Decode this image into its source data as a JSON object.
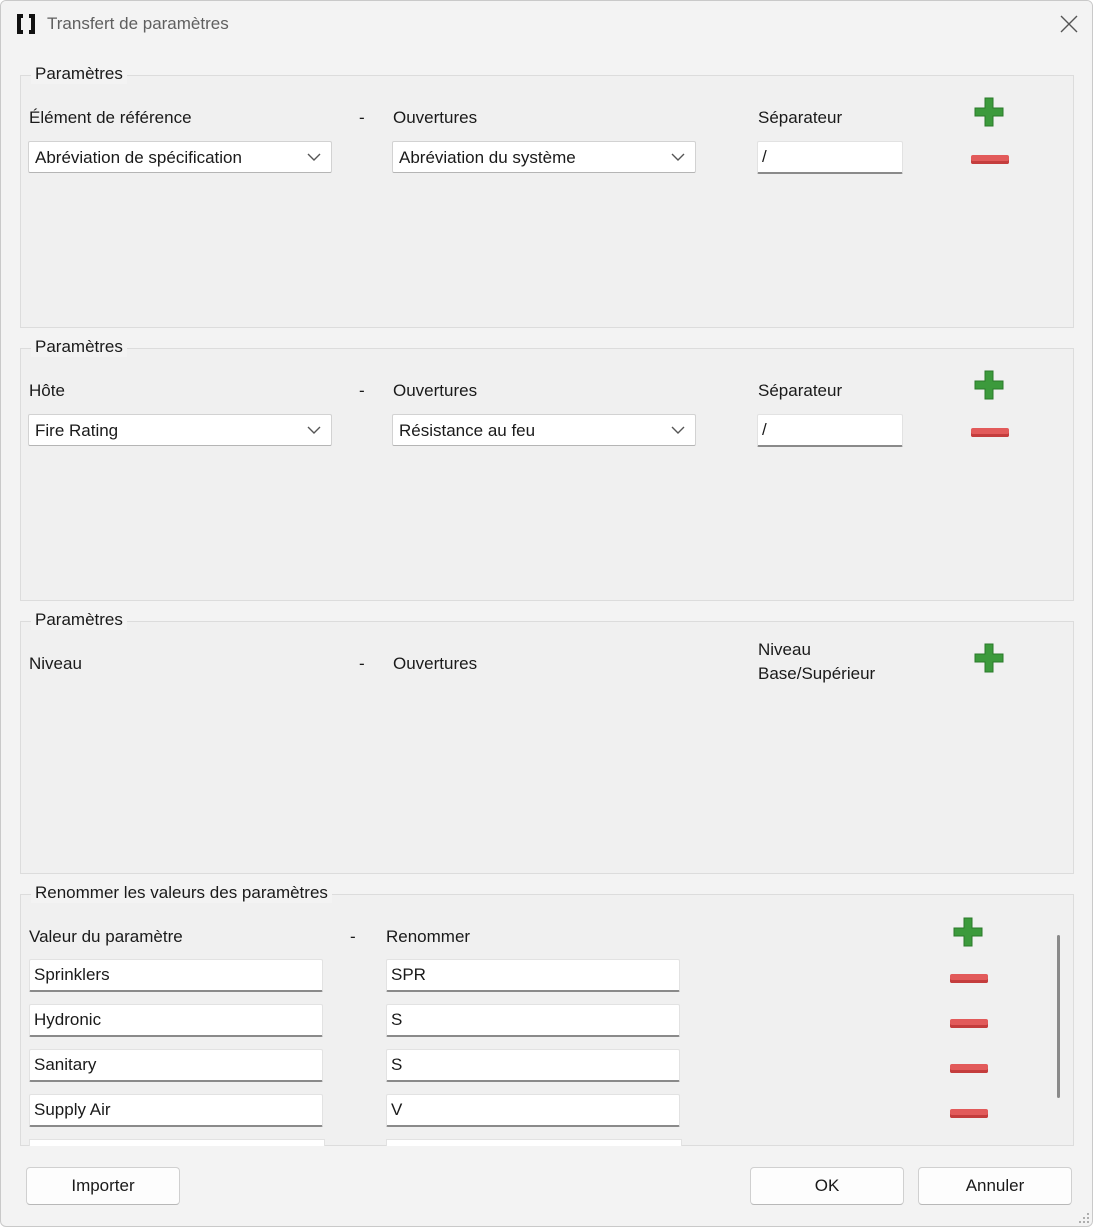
{
  "window": {
    "title": "Transfert de paramètres"
  },
  "section1": {
    "legend": "Paramètres",
    "col1_label": "Élément de référence",
    "dash": "-",
    "col2_label": "Ouvertures",
    "col3_label": "Séparateur",
    "col1_value": "Abréviation de spécification",
    "col2_value": "Abréviation du système",
    "separator_value": "/"
  },
  "section2": {
    "legend": "Paramètres",
    "col1_label": "Hôte",
    "dash": "-",
    "col2_label": "Ouvertures",
    "col3_label": "Séparateur",
    "col1_value": "Fire Rating",
    "col2_value": "Résistance au feu",
    "separator_value": "/"
  },
  "section3": {
    "legend": "Paramètres",
    "col1_label": "Niveau",
    "dash": "-",
    "col2_label": "Ouvertures",
    "col3_label": "Niveau Base/Supérieur"
  },
  "section4": {
    "legend": "Renommer les valeurs des paramètres",
    "col1_label": "Valeur du paramètre",
    "dash": "-",
    "col2_label": "Renommer",
    "rows": [
      {
        "value": "Sprinklers",
        "rename": "SPR"
      },
      {
        "value": "Hydronic",
        "rename": "S"
      },
      {
        "value": "Sanitary",
        "rename": "S"
      },
      {
        "value": "Supply Air",
        "rename": "V"
      }
    ]
  },
  "buttons": {
    "import": "Importer",
    "ok": "OK",
    "cancel": "Annuler"
  },
  "colors": {
    "add": "#3c9a3c",
    "remove": "#e25a5a"
  }
}
